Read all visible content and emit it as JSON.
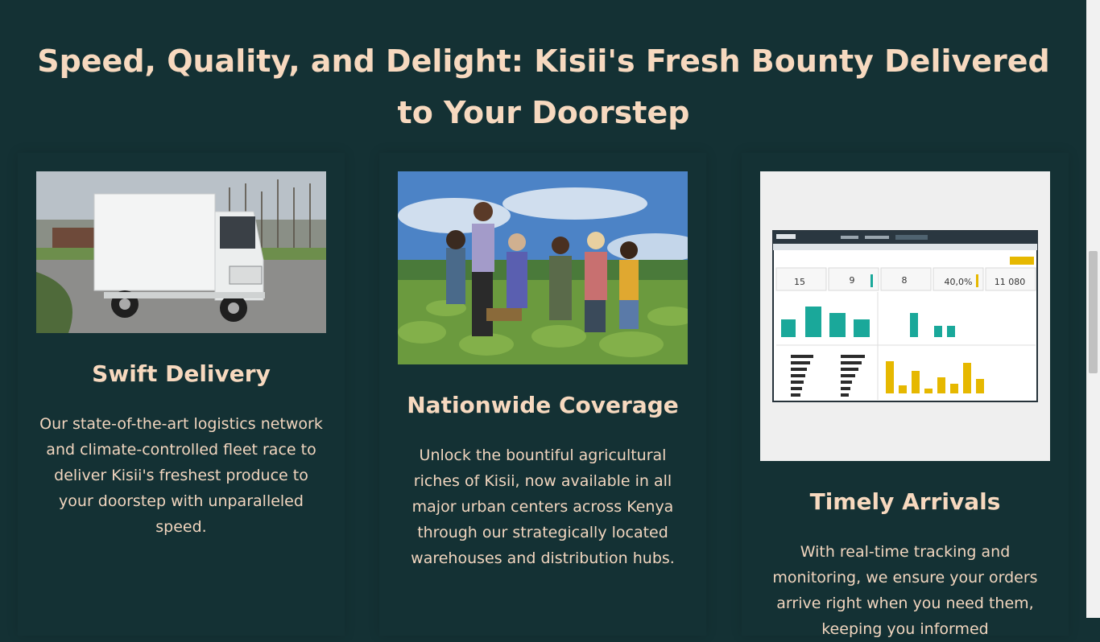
{
  "section": {
    "title": "Speed, Quality, and Delight: Kisii's Fresh Bounty Delivered to Your Doorstep"
  },
  "cards": [
    {
      "image": "white-delivery-truck-photo",
      "title": "Swift Delivery",
      "text": "Our state-of-the-art logistics network and climate-controlled fleet race to deliver Kisii's freshest produce to your doorstep with unparalleled speed."
    },
    {
      "image": "farmers-in-field-photo",
      "title": "Nationwide Coverage",
      "text": "Unlock the bountiful agricultural riches of Kisii, now available in all major urban centers across Kenya through our strategically located warehouses and distribution hubs."
    },
    {
      "image": "delivery-dashboard-screenshot",
      "title": "Timely Arrivals",
      "text": "With real-time tracking and monitoring, we ensure your orders arrive right when you need them, keeping you informed"
    }
  ],
  "dashboard": {
    "kpis": [
      "15",
      "9",
      "8",
      "40,0%",
      "11 080"
    ]
  },
  "colors": {
    "background": "#143134",
    "heading": "#f7d9bf",
    "dashboard_teal": "#1aa89a",
    "dashboard_yellow": "#e6b800"
  }
}
